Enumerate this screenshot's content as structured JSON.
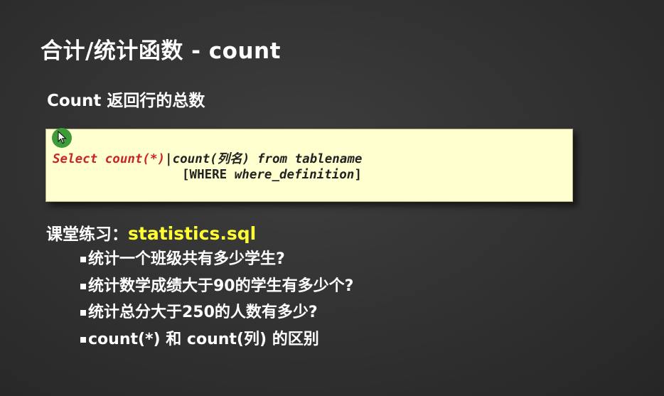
{
  "slide": {
    "title": "合计/统计函数 - count",
    "subtitle": "Count 返回行的总数",
    "code": {
      "line1_select": "Select count(*)",
      "line1_pipe": "|",
      "line1_count_col": "count(列名)",
      "line1_rest": " from tablename",
      "line2_where": "[WHERE ",
      "line2_def": "where_definition",
      "line2_close": "]"
    },
    "exercise": {
      "label": "课堂练习：",
      "file": "statistics.sql",
      "items": [
        "统计一个班级共有多少学生?",
        "统计数学成绩大于90的学生有多少个?",
        "统计总分大于250的人数有多少?",
        "count(*) 和 count(列) 的区别"
      ]
    },
    "colors": {
      "background": "#333333",
      "code_background": "#ffffcf",
      "code_keyword": "#c8262c",
      "highlight_file": "#ffff33",
      "cursor": "#3f9a3a"
    }
  }
}
